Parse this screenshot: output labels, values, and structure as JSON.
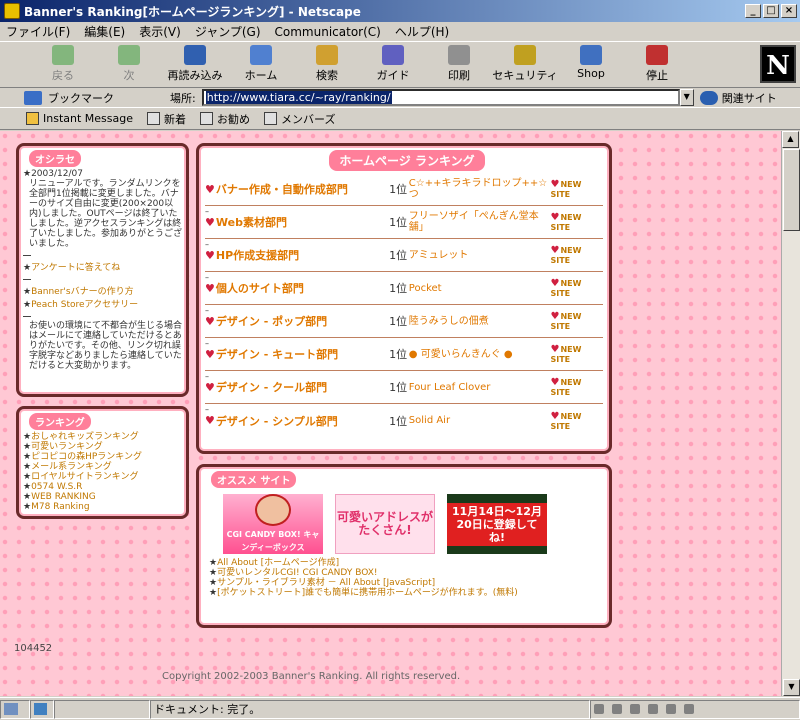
{
  "window": {
    "title": "Banner's Ranking[ホームページランキング] - Netscape",
    "minimize": "_",
    "maximize": "□",
    "close": "×"
  },
  "menu": [
    "ファイル(F)",
    "編集(E)",
    "表示(V)",
    "ジャンプ(G)",
    "Communicator(C)",
    "ヘルプ(H)"
  ],
  "toolbar": {
    "back": "戻る",
    "forward": "次",
    "reload": "再読み込み",
    "home": "ホーム",
    "search": "検索",
    "guide": "ガイド",
    "print": "印刷",
    "security": "セキュリティ",
    "shop": "Shop",
    "stop": "停止",
    "logo": "N"
  },
  "location": {
    "bookmarks": "ブックマーク",
    "label": "場所:",
    "url": "http://www.tiara.cc/~ray/ranking/",
    "related": "関連サイト"
  },
  "personal": [
    "Instant Message",
    "新着",
    "お勧め",
    "メンバーズ"
  ],
  "news": {
    "header": "オシラセ",
    "date": "★2003/12/07",
    "body": "リニューアルです。ランダムリンクを全部門1位掲載に変更しました。バナーのサイズ自由に変更(200×200以内)しました。OUTページは終了いたしました。逆アクセスランキングは終了いたしました。参加ありがとうございました。",
    "links": [
      "アンケートに答えてね"
    ],
    "links2": [
      "Banner'sバナーの作り方",
      "Peach Storeアクセサリー"
    ],
    "notice": "お使いの環境にて不都合が生じる場合はメールにて連絡していただけるとありがたいです。その他、リンク切れ誤字脱字などありましたら連絡していただけると大変助かります。"
  },
  "ranking": {
    "header": "ランキング",
    "items": [
      "おしゃれキッズランキング",
      "可愛いランキング",
      "ピコピコの森HPランキング",
      "メール系ランキング",
      "ロイヤルサイトランキング",
      "0574 W.S.R",
      "WEB RANKING",
      "M78 Ranking"
    ]
  },
  "main": {
    "header": "ホームページ ランキング",
    "rows": [
      {
        "cat": "バナー作成・自動作成部門",
        "pos": "1位",
        "site": "C☆++キラキラドロップ++☆つ",
        "ns": "NEW SITE"
      },
      {
        "cat": "Web素材部門",
        "pos": "1位",
        "site": "フリーソザイ「ぺんぎん堂本舗」",
        "ns": "NEW SITE"
      },
      {
        "cat": "HP作成支援部門",
        "pos": "1位",
        "site": "アミュレット",
        "ns": "NEW SITE"
      },
      {
        "cat": "個人のサイト部門",
        "pos": "1位",
        "site": "Pocket",
        "ns": "NEW SITE"
      },
      {
        "cat": "デザイン - ポップ部門",
        "pos": "1位",
        "site": "陸うみうしの佃煮",
        "ns": "NEW SITE"
      },
      {
        "cat": "デザイン - キュート部門",
        "pos": "1位",
        "site": "● 可愛いらんきんぐ ●",
        "ns": "NEW SITE"
      },
      {
        "cat": "デザイン - クール部門",
        "pos": "1位",
        "site": "Four Leaf Clover",
        "ns": "NEW SITE"
      },
      {
        "cat": "デザイン - シンプル部門",
        "pos": "1位",
        "site": "Solid Air",
        "ns": "NEW SITE"
      }
    ]
  },
  "osusume": {
    "header": "オススメ サイト",
    "banners": [
      {
        "text": "CGI CANDY BOX! キャンディーボックス"
      },
      {
        "text": "可愛いアドレスがたくさん!"
      },
      {
        "text": "11月14日～12月20日に登録してね!"
      }
    ],
    "links": [
      "All About [ホームページ作成]",
      "可愛いレンタルCGI!  CGI CANDY BOX!",
      "サンプル・ライブラリ素材 － All About [JavaScript]",
      "[ポケットストリート]誰でも簡単に携帯用ホームページが作れます。(無料)"
    ]
  },
  "counter": "104452",
  "copyright": "Copyright 2002-2003 Banner's Ranking. All rights reserved.",
  "status": {
    "text": "ドキュメント: 完了。"
  }
}
